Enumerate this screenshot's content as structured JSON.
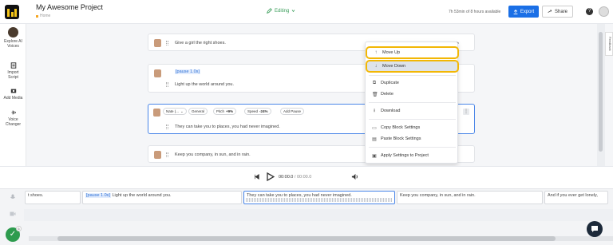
{
  "header": {
    "project_title": "My Awesome Project",
    "breadcrumb": "Home",
    "status": "Editing",
    "remaining_time": "7h 53min of 8 hours available",
    "export_label": "Export",
    "share_label": "Share",
    "help_label": "?"
  },
  "sidebar": {
    "items": [
      {
        "label1": "Explore AI",
        "label2": "Voices",
        "icon": "avatar-icon"
      },
      {
        "label1": "Import",
        "label2": "Script",
        "icon": "import-icon"
      },
      {
        "label1": "Add Media",
        "label2": "",
        "icon": "media-icon"
      },
      {
        "label1": "Voice",
        "label2": "Changer",
        "icon": "voice-changer-icon"
      }
    ]
  },
  "editor": {
    "blocks": [
      {
        "text": "Give a girl the right shoes."
      },
      {
        "pause": "[pause 1.0s]",
        "text": "Light up the world around you."
      },
      {
        "voice": "Nate (...",
        "style": "General",
        "pitch_label": "Pitch",
        "pitch_value": "+9%",
        "speed_label": "Speed",
        "speed_value": "-24%",
        "add_pause": "Add Pause",
        "text": "They can take you to places, you had never imagined."
      },
      {
        "text": "Keep you company, in sun, and in rain."
      }
    ],
    "feedback_label": "Feedback"
  },
  "context_menu": {
    "items": [
      {
        "label": "Move Up",
        "icon": "arrow-up-icon"
      },
      {
        "label": "Move Down",
        "icon": "arrow-down-icon"
      },
      {
        "label": "Duplicate",
        "icon": "duplicate-icon"
      },
      {
        "label": "Delete",
        "icon": "trash-icon"
      },
      {
        "label": "Download",
        "icon": "download-icon"
      },
      {
        "label": "Copy Block Settings",
        "icon": "copy-icon"
      },
      {
        "label": "Paste Block Settings",
        "icon": "paste-icon"
      },
      {
        "label": "Apply Settings to Project",
        "icon": "apply-icon"
      }
    ]
  },
  "playback": {
    "current": "00:00.0",
    "separator": "/",
    "duration": "00:00.0"
  },
  "timeline": {
    "clips": [
      {
        "text": "t shoes."
      },
      {
        "pause": "[pause 1.0s]",
        "text": "Light up the world around you."
      },
      {
        "text": "They can take you to places, you had never imagined."
      },
      {
        "text": "Keep you company, in sun, and in rain."
      },
      {
        "text": "And if you ever get lonely,"
      }
    ]
  },
  "colors": {
    "accent": "#1a6fe6",
    "highlight": "#f2b705",
    "editing": "#3a9d5a",
    "selected_border": "#4a86e8"
  },
  "notifications": {
    "badge_count": "6"
  }
}
